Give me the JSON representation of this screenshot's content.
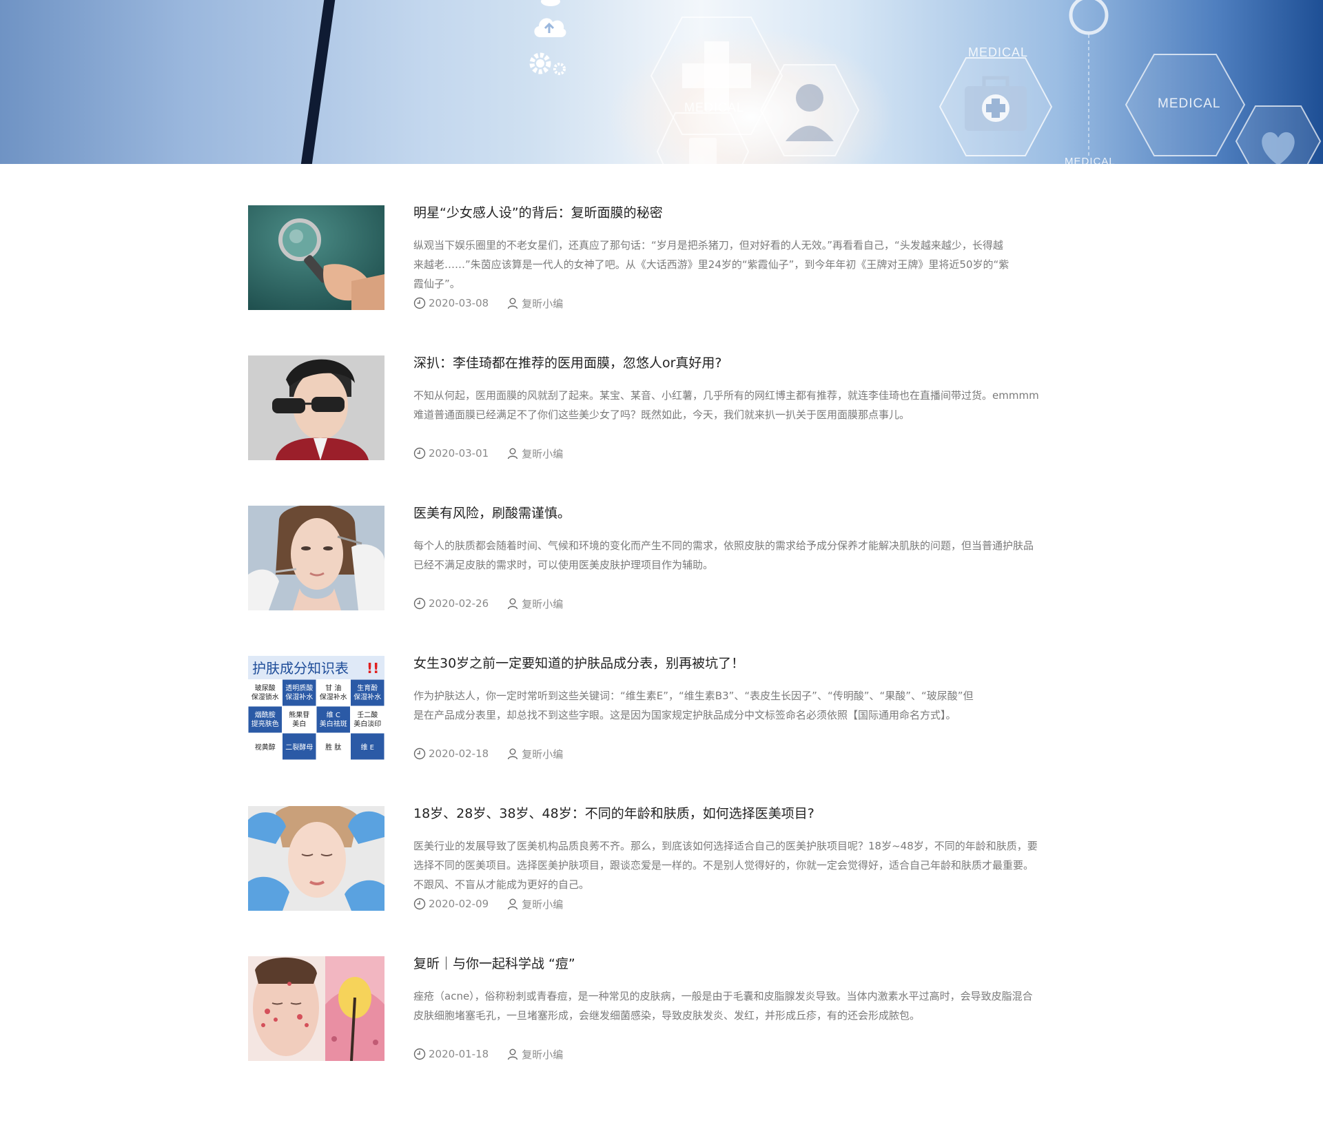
{
  "banner": {
    "labels": [
      "MEDICAL",
      "MEDICAL",
      "MEDICAL",
      "MEDICAL"
    ],
    "icons": [
      "cloud-upload-icon",
      "gears-icon",
      "medical-cross-icon",
      "doctor-icon",
      "medical-kit-icon",
      "heart-icon",
      "clipboard-icon"
    ]
  },
  "articles": [
    {
      "title": "明星“少女感人设”的背后：复昕面膜的秘密",
      "summary_lines": [
        "纵观当下娱乐圈里的不老女星们，还真应了那句话：“岁月是把杀猪刀，但对好看的人无效。”再看看自己，“头发越来越少，长得越",
        "来越老……”朱茵应该算是一代人的女神了吧。从《大话西游》里24岁的“紫霞仙子”，到今年年初《王牌对王牌》里将近50岁的“紫",
        "霞仙子”。"
      ],
      "date": "2020-03-08",
      "author": "复昕小编",
      "image": "magnifying-glass-photo"
    },
    {
      "title": "深扒：李佳琦都在推荐的医用面膜，忽悠人or真好用?",
      "summary_lines": [
        "不知从何起，医用面膜的风就刮了起来。某宝、某音、小红薯，几乎所有的网红博主都有推荐，就连李佳琦也在直播间带过货。emmmm",
        "难道普通面膜已经满足不了你们这些美少女了吗？既然如此，今天，我们就来扒一扒关于医用面膜那点事儿。"
      ],
      "date": "2020-03-01",
      "author": "复昕小编",
      "image": "man-sunglasses-photo"
    },
    {
      "title": "医美有风险，刷酸需谨慎。",
      "summary_lines": [
        "每个人的肤质都会随着时间、气候和环境的变化而产生不同的需求，依照皮肤的需求给予成分保养才能解决肌肤的问题，但当普通护肤品",
        "已经不满足皮肤的需求时，可以使用医美皮肤护理项目作为辅助。"
      ],
      "date": "2020-02-26",
      "author": "复昕小编",
      "image": "woman-injection-photo"
    },
    {
      "title": "女生30岁之前一定要知道的护肤品成分表，别再被坑了！",
      "summary_lines": [
        "作为护肤达人，你一定时常听到这些关键词：“维生素E”，“维生素B3”、“表皮生长因子”、“传明酸”、“果酸”、“玻尿酸”但",
        "是在产品成分表里，却总找不到这些字眼。这是因为国家规定护肤品成分中文标签命名必须依照【国际通用命名方式】。"
      ],
      "date": "2020-02-18",
      "author": "复昕小编",
      "image": "ingredients-table-graphic",
      "image_text": {
        "header": "护肤成分知识表",
        "exclaim": "!!",
        "cells": [
          [
            "玻尿酸",
            "保湿锁水"
          ],
          [
            "透明质酸",
            "保湿补水"
          ],
          [
            "甘 油",
            "保湿补水"
          ],
          [
            "生育酚",
            "保湿补水"
          ],
          [
            "烟酰胺",
            "提亮肤色"
          ],
          [
            "熊果苷",
            "美白"
          ],
          [
            "维 C",
            "美白祛斑"
          ],
          [
            "壬二酸",
            "美白淡印"
          ],
          [
            "视黄醇",
            ""
          ],
          [
            "二裂酵母",
            ""
          ],
          [
            "胜 肽",
            ""
          ],
          [
            "维 E",
            ""
          ]
        ]
      }
    },
    {
      "title": "18岁、28岁、38岁、48岁：不同的年龄和肤质，如何选择医美项目?",
      "summary_lines": [
        "医美行业的发展导致了医美机构品质良莠不齐。那么，到底该如何选择适合自己的医美护肤项目呢？18岁~48岁，不同的年龄和肤质，要",
        "选择不同的医美项目。选择医美护肤项目，跟谈恋爱是一样的。不是别人觉得好的，你就一定会觉得好，适合自己年龄和肤质才最重要。",
        "不跟风、不盲从才能成为更好的自己。"
      ],
      "date": "2020-02-09",
      "author": "复昕小编",
      "image": "facial-treatment-photo"
    },
    {
      "title": "复昕｜与你一起科学战 “痘”",
      "summary_lines": [
        "痤疮（acne），俗称粉刺或青春痘，是一种常见的皮肤病，一般是由于毛囊和皮脂腺发炎导致。当体内激素水平过高时，会导致皮脂混合",
        "皮肤细胞堵塞毛孔，一旦堵塞形成，会继发细菌感染，导致皮肤发炎、发红，并形成丘疹，有的还会形成脓包。"
      ],
      "date": "2020-01-18",
      "author": "复昕小编",
      "image": "acne-illustration"
    }
  ],
  "icons": {
    "date": "clock-icon",
    "author": "user-icon"
  },
  "colors": {
    "title": "#222222",
    "summary": "#7a7a7a",
    "meta": "#8a8a8a",
    "table_blue": "#2b5aa6"
  }
}
